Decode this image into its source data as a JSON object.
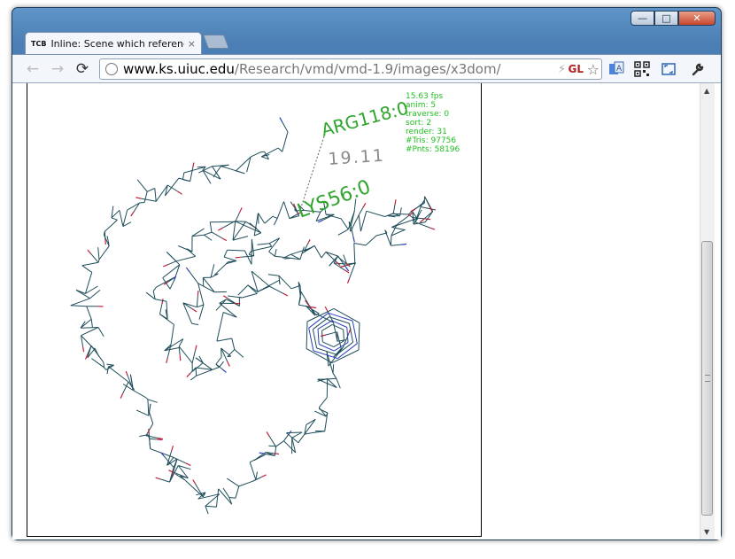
{
  "window": {
    "minimize_icon": "minimize-icon",
    "maximize_icon": "maximize-icon",
    "close_icon": "close-icon"
  },
  "tab": {
    "favicon": "TCB",
    "title": "Inline: Scene which referenc",
    "close": "×"
  },
  "toolbar": {
    "back": "←",
    "forward": "→",
    "reload": "⟳",
    "url_host": "www.ks.uiuc.edu",
    "url_path": "/Research/vmd/vmd-1.9/images/x3dom/",
    "gl_badge": "GL",
    "bolt": "⚡",
    "star": "☆",
    "wrench": "🔧"
  },
  "viewer": {
    "labels": {
      "arg": "ARG118:0",
      "distance": "19.11",
      "lys": "LYS56:0"
    },
    "stats": [
      "15.63 fps",
      "anim: 5",
      "traverse: 0",
      "sort: 2",
      "render: 31",
      "#Tris: 97756",
      "#Pnts: 58196"
    ],
    "colors": {
      "label": "#2fa52f",
      "distance": "#8a8a8a",
      "backbone": "#1e4d5a",
      "atom_red": "#c0203a",
      "atom_blue": "#2a3fbf",
      "stats": "#1fbf1f"
    }
  }
}
